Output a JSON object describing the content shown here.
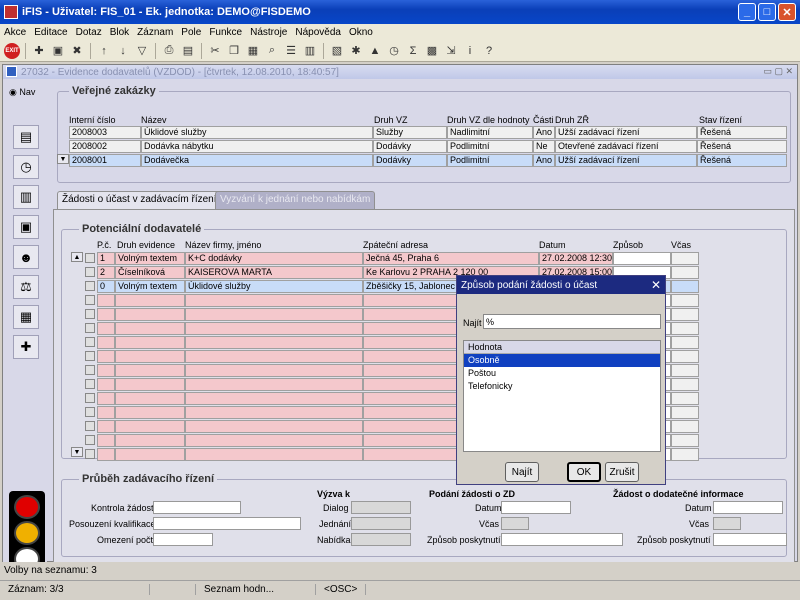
{
  "window": {
    "title": "iFIS - Uživatel: FIS_01 - Ek. jednotka: DEMO@FISDEMO"
  },
  "menu": [
    "Akce",
    "Editace",
    "Dotaz",
    "Blok",
    "Záznam",
    "Pole",
    "Funkce",
    "Nástroje",
    "Nápověda",
    "Okno"
  ],
  "form": {
    "title": "27032 - Evidence dodavatelů (VZDOD) - [čtvrtek, 12.08.2010, 18:40:57]"
  },
  "nav": {
    "label": "Nav"
  },
  "zakazky": {
    "title": "Veřejné zakázky",
    "headers": {
      "interni": "Interní číslo",
      "nazev": "Název",
      "druh": "Druh VZ",
      "druh_hodnoty": "Druh VZ dle hodnoty",
      "casti": "Části",
      "druh_zr": "Druh ZŘ",
      "stav": "Stav řízení"
    },
    "rows": [
      {
        "interni": "2008003",
        "nazev": "Úklidové služby",
        "druh": "Služby",
        "druh_hodnoty": "Nadlimitní",
        "casti": "Ano",
        "druh_zr": "Užší zadávací řízení",
        "stav": "Řešená"
      },
      {
        "interni": "2008002",
        "nazev": "Dodávka nábytku",
        "druh": "Dodávky",
        "druh_hodnoty": "Podlimitní",
        "casti": "Ne",
        "druh_zr": "Otevřené zadávací řízení",
        "stav": "Řešená"
      },
      {
        "interni": "2008001",
        "nazev": "Dodávečka",
        "druh": "Dodávky",
        "druh_hodnoty": "Podlimitní",
        "casti": "Ano",
        "druh_zr": "Užší zadávací řízení",
        "stav": "Řešená"
      }
    ]
  },
  "tabs": {
    "active": "Žádosti o účast v zadávacím řízení",
    "inactive": "Vyzvání k jednání nebo nabídkám"
  },
  "dodavatele": {
    "title": "Potenciální dodavatelé",
    "headers": {
      "pc": "P.č.",
      "druh": "Druh evidence",
      "nazev": "Název firmy, jméno",
      "adresa": "Zpáteční adresa",
      "datum": "Datum",
      "zpusob": "Způsob",
      "vcas": "Včas"
    },
    "rows": [
      {
        "pc": "1",
        "druh": "Volným textem",
        "nazev": "K+C dodávky",
        "adresa": "Ječná 45, Praha 6",
        "datum": "27.02.2008 12:30"
      },
      {
        "pc": "2",
        "druh": "Číselníková",
        "nazev": "KAISEROVA MARTA",
        "adresa": "Ke Karlovu 2 PRAHA 2 120 00",
        "datum": "27.02.2008 15:00"
      },
      {
        "pc": "0",
        "druh": "Volným textem",
        "nazev": "Úklidové služby",
        "adresa": "Zběšičky 15, Jablonec",
        "datum": ""
      }
    ]
  },
  "prubeh": {
    "title": "Průběh zadávacího řízení",
    "kontrola": "Kontrola žádostí",
    "posouzeni": "Posouzení kvalifikace",
    "omezeni": "Omezení počtu",
    "vyzva": "Výzva k",
    "dialog": "Dialog",
    "jednani": "Jednání",
    "nabidka": "Nabídka",
    "podani": "Podání žádosti o ZD",
    "datum": "Datum",
    "vcas": "Včas",
    "zpusob": "Způsob poskytnutí",
    "zadost": "Žádost o dodatečné informace",
    "datum2": "Datum",
    "vcas2": "Včas",
    "zpusob2": "Způsob poskytnutí"
  },
  "status": {
    "volby": "Volby na seznamu: 3",
    "zaznam": "Záznam: 3/3",
    "seznam": "Seznam hodn...",
    "osc": "<OSC>"
  },
  "dialog": {
    "title": "Způsob podání žádosti o účast",
    "najit_label": "Najít",
    "najit_value": "%",
    "list_header": "Hodnota",
    "items": [
      "Osobně",
      "Poštou",
      "Telefonicky"
    ],
    "btn_najit": "Najít",
    "btn_ok": "OK",
    "btn_zrusit": "Zrušit"
  }
}
